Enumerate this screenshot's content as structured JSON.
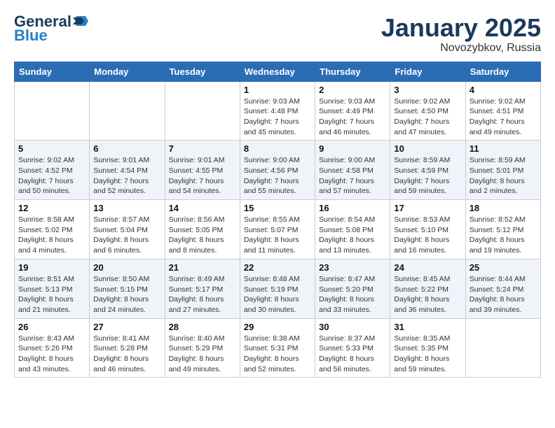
{
  "header": {
    "logo_line1": "General",
    "logo_line2": "Blue",
    "month": "January 2025",
    "location": "Novozybkov, Russia"
  },
  "weekdays": [
    "Sunday",
    "Monday",
    "Tuesday",
    "Wednesday",
    "Thursday",
    "Friday",
    "Saturday"
  ],
  "weeks": [
    [
      {
        "day": "",
        "info": ""
      },
      {
        "day": "",
        "info": ""
      },
      {
        "day": "",
        "info": ""
      },
      {
        "day": "1",
        "info": "Sunrise: 9:03 AM\nSunset: 4:48 PM\nDaylight: 7 hours and 45 minutes."
      },
      {
        "day": "2",
        "info": "Sunrise: 9:03 AM\nSunset: 4:49 PM\nDaylight: 7 hours and 46 minutes."
      },
      {
        "day": "3",
        "info": "Sunrise: 9:02 AM\nSunset: 4:50 PM\nDaylight: 7 hours and 47 minutes."
      },
      {
        "day": "4",
        "info": "Sunrise: 9:02 AM\nSunset: 4:51 PM\nDaylight: 7 hours and 49 minutes."
      }
    ],
    [
      {
        "day": "5",
        "info": "Sunrise: 9:02 AM\nSunset: 4:52 PM\nDaylight: 7 hours and 50 minutes."
      },
      {
        "day": "6",
        "info": "Sunrise: 9:01 AM\nSunset: 4:54 PM\nDaylight: 7 hours and 52 minutes."
      },
      {
        "day": "7",
        "info": "Sunrise: 9:01 AM\nSunset: 4:55 PM\nDaylight: 7 hours and 54 minutes."
      },
      {
        "day": "8",
        "info": "Sunrise: 9:00 AM\nSunset: 4:56 PM\nDaylight: 7 hours and 55 minutes."
      },
      {
        "day": "9",
        "info": "Sunrise: 9:00 AM\nSunset: 4:58 PM\nDaylight: 7 hours and 57 minutes."
      },
      {
        "day": "10",
        "info": "Sunrise: 8:59 AM\nSunset: 4:59 PM\nDaylight: 7 hours and 59 minutes."
      },
      {
        "day": "11",
        "info": "Sunrise: 8:59 AM\nSunset: 5:01 PM\nDaylight: 8 hours and 2 minutes."
      }
    ],
    [
      {
        "day": "12",
        "info": "Sunrise: 8:58 AM\nSunset: 5:02 PM\nDaylight: 8 hours and 4 minutes."
      },
      {
        "day": "13",
        "info": "Sunrise: 8:57 AM\nSunset: 5:04 PM\nDaylight: 8 hours and 6 minutes."
      },
      {
        "day": "14",
        "info": "Sunrise: 8:56 AM\nSunset: 5:05 PM\nDaylight: 8 hours and 8 minutes."
      },
      {
        "day": "15",
        "info": "Sunrise: 8:55 AM\nSunset: 5:07 PM\nDaylight: 8 hours and 11 minutes."
      },
      {
        "day": "16",
        "info": "Sunrise: 8:54 AM\nSunset: 5:08 PM\nDaylight: 8 hours and 13 minutes."
      },
      {
        "day": "17",
        "info": "Sunrise: 8:53 AM\nSunset: 5:10 PM\nDaylight: 8 hours and 16 minutes."
      },
      {
        "day": "18",
        "info": "Sunrise: 8:52 AM\nSunset: 5:12 PM\nDaylight: 8 hours and 19 minutes."
      }
    ],
    [
      {
        "day": "19",
        "info": "Sunrise: 8:51 AM\nSunset: 5:13 PM\nDaylight: 8 hours and 21 minutes."
      },
      {
        "day": "20",
        "info": "Sunrise: 8:50 AM\nSunset: 5:15 PM\nDaylight: 8 hours and 24 minutes."
      },
      {
        "day": "21",
        "info": "Sunrise: 8:49 AM\nSunset: 5:17 PM\nDaylight: 8 hours and 27 minutes."
      },
      {
        "day": "22",
        "info": "Sunrise: 8:48 AM\nSunset: 5:19 PM\nDaylight: 8 hours and 30 minutes."
      },
      {
        "day": "23",
        "info": "Sunrise: 8:47 AM\nSunset: 5:20 PM\nDaylight: 8 hours and 33 minutes."
      },
      {
        "day": "24",
        "info": "Sunrise: 8:45 AM\nSunset: 5:22 PM\nDaylight: 8 hours and 36 minutes."
      },
      {
        "day": "25",
        "info": "Sunrise: 8:44 AM\nSunset: 5:24 PM\nDaylight: 8 hours and 39 minutes."
      }
    ],
    [
      {
        "day": "26",
        "info": "Sunrise: 8:43 AM\nSunset: 5:26 PM\nDaylight: 8 hours and 43 minutes."
      },
      {
        "day": "27",
        "info": "Sunrise: 8:41 AM\nSunset: 5:28 PM\nDaylight: 8 hours and 46 minutes."
      },
      {
        "day": "28",
        "info": "Sunrise: 8:40 AM\nSunset: 5:29 PM\nDaylight: 8 hours and 49 minutes."
      },
      {
        "day": "29",
        "info": "Sunrise: 8:38 AM\nSunset: 5:31 PM\nDaylight: 8 hours and 52 minutes."
      },
      {
        "day": "30",
        "info": "Sunrise: 8:37 AM\nSunset: 5:33 PM\nDaylight: 8 hours and 56 minutes."
      },
      {
        "day": "31",
        "info": "Sunrise: 8:35 AM\nSunset: 5:35 PM\nDaylight: 8 hours and 59 minutes."
      },
      {
        "day": "",
        "info": ""
      }
    ]
  ]
}
